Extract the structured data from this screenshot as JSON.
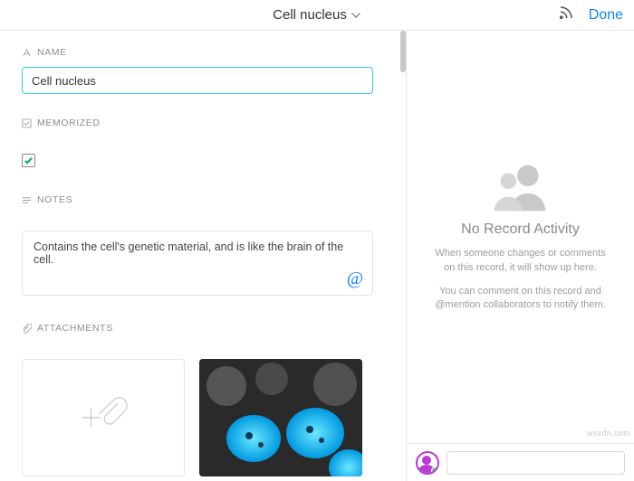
{
  "header": {
    "title": "Cell nucleus",
    "done_label": "Done"
  },
  "fields": {
    "name": {
      "label": "NAME",
      "value": "Cell nucleus"
    },
    "memorized": {
      "label": "MEMORIZED",
      "checked": true
    },
    "notes": {
      "label": "NOTES",
      "value": "Contains the cell's genetic material, and is like the brain of the cell."
    },
    "attachments": {
      "label": "ATTACHMENTS"
    }
  },
  "activity": {
    "title": "No Record Activity",
    "body1": "When someone changes or comments on this record, it will show up here.",
    "body2": "You can comment on this record and @mention collaborators to notify them."
  },
  "comment": {
    "placeholder": ""
  },
  "watermark": "wsxdn.com"
}
